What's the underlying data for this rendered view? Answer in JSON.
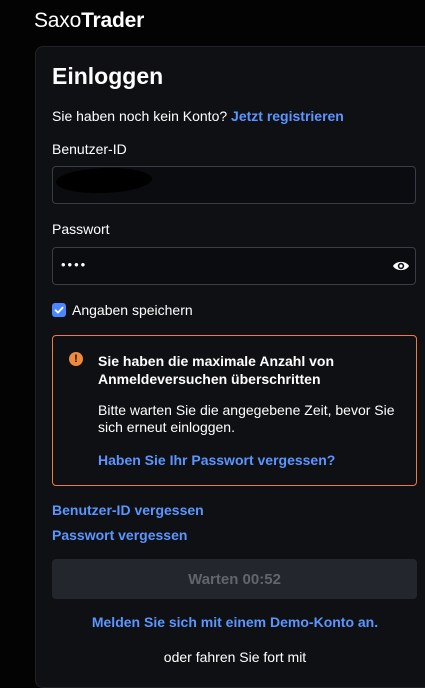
{
  "brand": {
    "part1": "Saxo",
    "part2": "Trader"
  },
  "login": {
    "title": "Einloggen",
    "no_account_text": "Sie haben noch kein Konto?",
    "register_link": "Jetzt registrieren",
    "user_id_label": "Benutzer-ID",
    "password_label": "Passwort",
    "password_mask": "••••",
    "remember_label": "Angaben speichern",
    "remember_checked": true
  },
  "alert": {
    "icon": "alert-icon",
    "title": "Sie haben die maximale Anzahl von Anmeldeversuchen überschritten",
    "body": "Bitte warten Sie die angegebene Zeit, bevor Sie sich erneut einloggen.",
    "link": "Haben Sie Ihr Passwort vergessen?",
    "border_color": "#ef7b3c"
  },
  "links": {
    "forgot_user_id": "Benutzer-ID vergessen",
    "forgot_password": "Passwort vergessen"
  },
  "wait_button": "Warten 00:52",
  "demo_link": "Melden Sie sich mit einem Demo-Konto an.",
  "continue_text": "oder fahren Sie fort mit",
  "colors": {
    "accent": "#5b95ff",
    "warning": "#f08a3a",
    "background": "#030303",
    "panel": "#0f1014"
  }
}
